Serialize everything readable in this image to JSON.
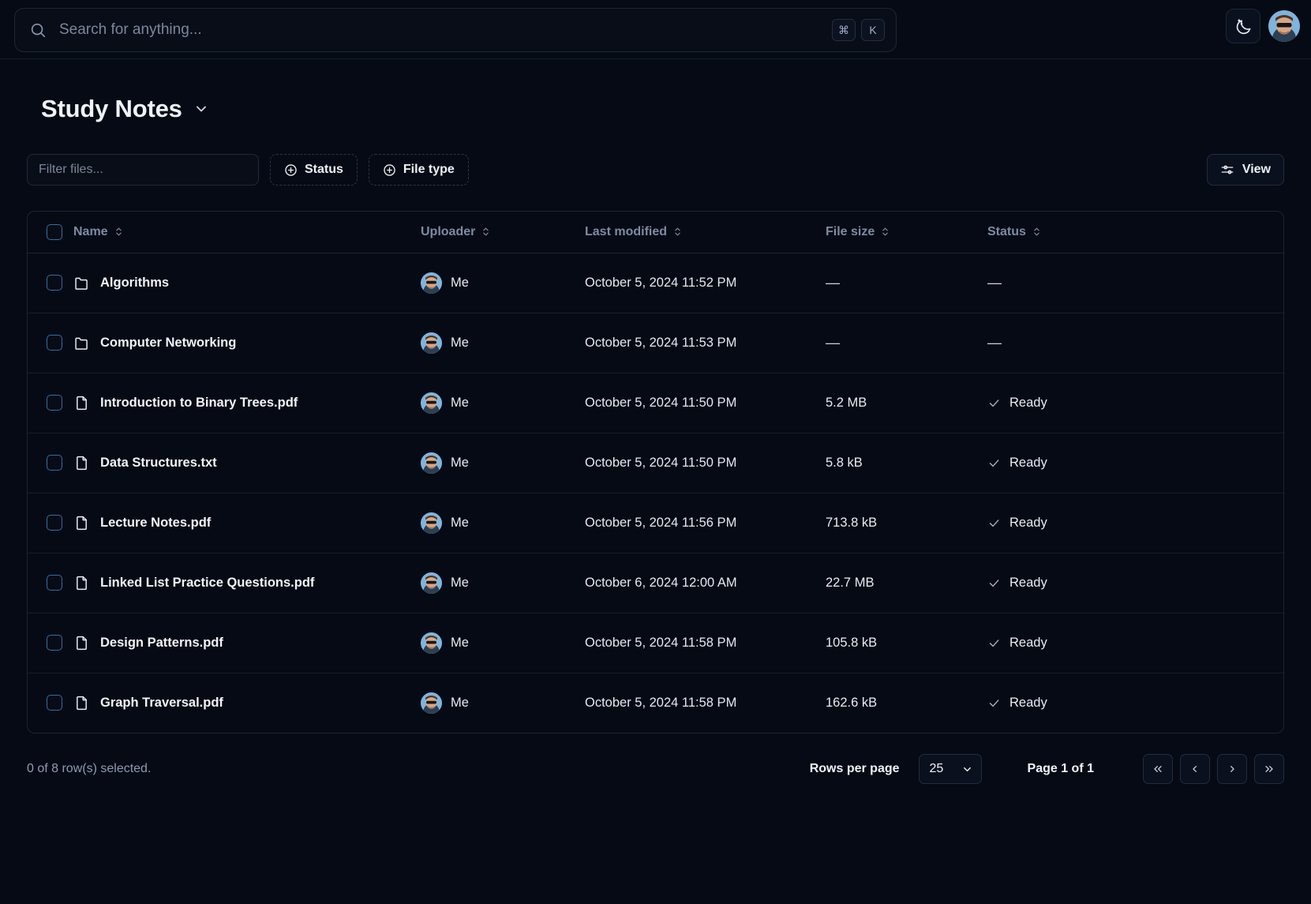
{
  "search": {
    "placeholder": "Search for anything...",
    "shortcut_keys": [
      "⌘",
      "K"
    ],
    "icon": "search-icon"
  },
  "topbar": {
    "theme_toggle_icon": "moon-stars-icon",
    "avatar_icon": "user-avatar"
  },
  "header": {
    "title": "Study Notes",
    "chevron_icon": "chevron-down-icon"
  },
  "toolbar": {
    "filter_placeholder": "Filter files...",
    "filter_value": "",
    "status_facet_label": "Status",
    "filetype_facet_label": "File type",
    "facet_icon": "plus-circle-icon",
    "view_label": "View",
    "view_icon": "sliders-icon"
  },
  "table": {
    "columns": [
      {
        "key": "name",
        "label": "Name",
        "sortable": true
      },
      {
        "key": "uploader",
        "label": "Uploader",
        "sortable": true
      },
      {
        "key": "modified",
        "label": "Last modified",
        "sortable": true
      },
      {
        "key": "size",
        "label": "File size",
        "sortable": true
      },
      {
        "key": "status",
        "label": "Status",
        "sortable": true
      }
    ],
    "sort_icon": "chevron-up-down-icon",
    "rows": [
      {
        "icon": "folder-icon",
        "name": "Algorithms",
        "uploader": "Me",
        "modified": "October 5, 2024 11:52 PM",
        "size": "—",
        "status": "—",
        "status_has_check": false,
        "selected": false
      },
      {
        "icon": "folder-icon",
        "name": "Computer Networking",
        "uploader": "Me",
        "modified": "October 5, 2024 11:53 PM",
        "size": "—",
        "status": "—",
        "status_has_check": false,
        "selected": false
      },
      {
        "icon": "file-icon",
        "name": "Introduction to Binary Trees.pdf",
        "uploader": "Me",
        "modified": "October 5, 2024 11:50 PM",
        "size": "5.2 MB",
        "status": "Ready",
        "status_has_check": true,
        "selected": false
      },
      {
        "icon": "file-icon",
        "name": "Data Structures.txt",
        "uploader": "Me",
        "modified": "October 5, 2024 11:50 PM",
        "size": "5.8 kB",
        "status": "Ready",
        "status_has_check": true,
        "selected": false
      },
      {
        "icon": "file-icon",
        "name": "Lecture Notes.pdf",
        "uploader": "Me",
        "modified": "October 5, 2024 11:56 PM",
        "size": "713.8 kB",
        "status": "Ready",
        "status_has_check": true,
        "selected": false
      },
      {
        "icon": "file-icon",
        "name": "Linked List Practice Questions.pdf",
        "uploader": "Me",
        "modified": "October 6, 2024 12:00 AM",
        "size": "22.7 MB",
        "status": "Ready",
        "status_has_check": true,
        "selected": false
      },
      {
        "icon": "file-icon",
        "name": "Design Patterns.pdf",
        "uploader": "Me",
        "modified": "October 5, 2024 11:58 PM",
        "size": "105.8 kB",
        "status": "Ready",
        "status_has_check": true,
        "selected": false
      },
      {
        "icon": "file-icon",
        "name": "Graph Traversal.pdf",
        "uploader": "Me",
        "modified": "October 5, 2024 11:58 PM",
        "size": "162.6 kB",
        "status": "Ready",
        "status_has_check": true,
        "selected": false
      }
    ]
  },
  "footer": {
    "rows_selected": "0 of 8 row(s) selected.",
    "rows_per_page_label": "Rows per page",
    "rows_per_page_value": "25",
    "page_label": "Page 1 of 1",
    "first_page_icon": "chevrons-left-icon",
    "prev_page_icon": "chevron-left-icon",
    "next_page_icon": "chevron-right-icon",
    "last_page_icon": "chevrons-right-icon"
  },
  "colors": {
    "background": "#060a14",
    "panel": "#080d18",
    "border": "#1b2536",
    "text": "#eef3fa",
    "muted": "#7e8ba2",
    "checkbox_border": "#2f6ea8"
  }
}
